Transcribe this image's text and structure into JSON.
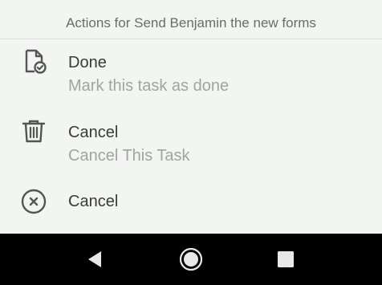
{
  "sheet": {
    "title": "Actions for Send Benjamin the new forms",
    "actions": [
      {
        "label": "Done",
        "sublabel": "Mark this task as done",
        "icon": "task-done-icon"
      },
      {
        "label": "Cancel",
        "sublabel": "Cancel This Task",
        "icon": "trash-icon"
      },
      {
        "label": "Cancel",
        "icon": "close-circle-icon"
      }
    ]
  },
  "navbar": {
    "buttons": [
      "back-icon",
      "home-icon",
      "recents-icon"
    ]
  },
  "colors": {
    "sheet_background": "#f3f5f3",
    "label": "#3a3a3a",
    "sublabel": "#a3a3a3",
    "title": "#6b6b6b",
    "icon": "#555555",
    "navbar": "#000000"
  }
}
